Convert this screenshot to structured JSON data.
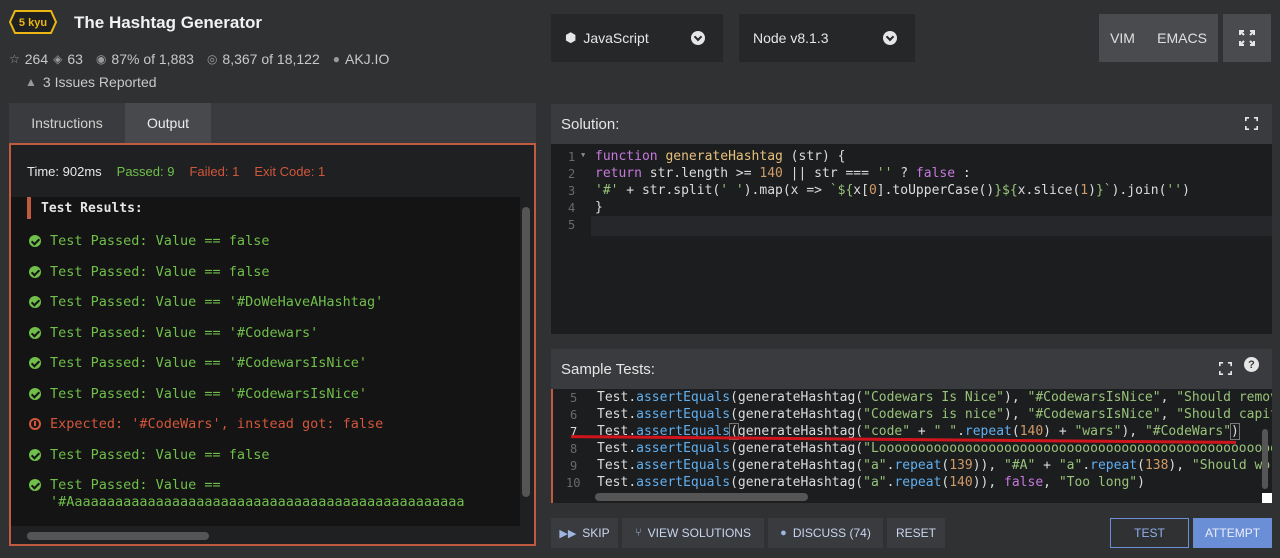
{
  "kata": {
    "rank": "5 kyu",
    "title": "The Hashtag Generator",
    "stars": "264",
    "collections": "63",
    "satisfaction": "87% of 1,883",
    "completed_prefix": "8,367 of 18,122",
    "author": "AKJ.IO",
    "issues": "3 Issues Reported"
  },
  "toolbar": {
    "language": "JavaScript",
    "runtime": "Node v8.1.3",
    "vim": "VIM",
    "emacs": "EMACS"
  },
  "left_tabs": [
    "Instructions",
    "Output"
  ],
  "output": {
    "time_label": "Time: 902ms",
    "passed_label": "Passed: 9",
    "failed_label": "Failed: 1",
    "exit_label": "Exit Code: 1",
    "results_heading": "Test Results:",
    "lines": [
      {
        "status": "pass",
        "text": "Test Passed: Value == false"
      },
      {
        "status": "pass",
        "text": "Test Passed: Value == false"
      },
      {
        "status": "pass",
        "text": "Test Passed: Value == '#DoWeHaveAHashtag'"
      },
      {
        "status": "pass",
        "text": "Test Passed: Value == '#Codewars'"
      },
      {
        "status": "pass",
        "text": "Test Passed: Value == '#CodewarsIsNice'"
      },
      {
        "status": "pass",
        "text": "Test Passed: Value == '#CodewarsIsNice'"
      },
      {
        "status": "fail",
        "text": "Expected: '#CodeWars', instead got: false"
      },
      {
        "status": "pass",
        "text": "Test Passed: Value == false"
      },
      {
        "status": "pass",
        "text": "Test Passed: Value =="
      },
      {
        "status": "cont",
        "text": "'#Aaaaaaaaaaaaaaaaaaaaaaaaaaaaaaaaaaaaaaaaaaaaaaaaa"
      }
    ]
  },
  "solution": {
    "title": "Solution:",
    "line_numbers": [
      "1",
      "2",
      "3",
      "4",
      "5"
    ]
  },
  "sample_tests": {
    "title": "Sample Tests:",
    "help": "?",
    "line_numbers": [
      "5",
      "6",
      "7",
      "8",
      "9",
      "10"
    ],
    "line5": [
      "Test",
      ".",
      "assertEquals",
      "(",
      "generateHashtag",
      "(",
      "\"Codewars Is Nice\"",
      "), ",
      "\"#CodewarsIsNice\"",
      ", ",
      "\"Should remove"
    ],
    "line6": [
      "Test",
      ".",
      "assertEquals",
      "(",
      "generateHashtag",
      "(",
      "\"Codewars is nice\"",
      "), ",
      "\"#CodewarsIsNice\"",
      ", ",
      "\"Should capital"
    ],
    "line7": [
      "Test",
      ".",
      "assertEquals",
      "(",
      "generateHashtag",
      "(",
      "\"code\"",
      " + ",
      "\" \"",
      ".",
      "repeat",
      "(",
      "140",
      ") + ",
      "\"wars\"",
      "), ",
      "\"#CodeWars\"",
      ")"
    ],
    "line8": [
      "Test",
      ".",
      "assertEquals",
      "(",
      "generateHashtag",
      "(",
      "\"Looooooooooooooooooooooooooooooooooooooooooooooooooooooooooooooooooooooooooo"
    ],
    "line9": [
      "Test",
      ".",
      "assertEquals",
      "(",
      "generateHashtag",
      "(",
      "\"a\"",
      ".",
      "repeat",
      "(",
      "139",
      ")), ",
      "\"#A\"",
      " + ",
      "\"a\"",
      ".",
      "repeat",
      "(",
      "138",
      "), ",
      "\"Should work"
    ],
    "line10": [
      "Test",
      ".",
      "assertEquals",
      "(",
      "generateHashtag",
      "(",
      "\"a\"",
      ".",
      "repeat",
      "(",
      "140",
      ")), ",
      "false",
      ", ",
      "\"Too long\"",
      ")"
    ]
  },
  "buttons": {
    "skip": "SKIP",
    "view_solutions": "VIEW SOLUTIONS",
    "discuss": "DISCUSS (74)",
    "reset": "RESET",
    "test": "TEST",
    "attempt": "ATTEMPT"
  },
  "colors": {
    "accent_border": "#c15b3f",
    "pass": "#6fbf4a",
    "fail": "#d2563b",
    "primary": "#6b8fd6"
  }
}
